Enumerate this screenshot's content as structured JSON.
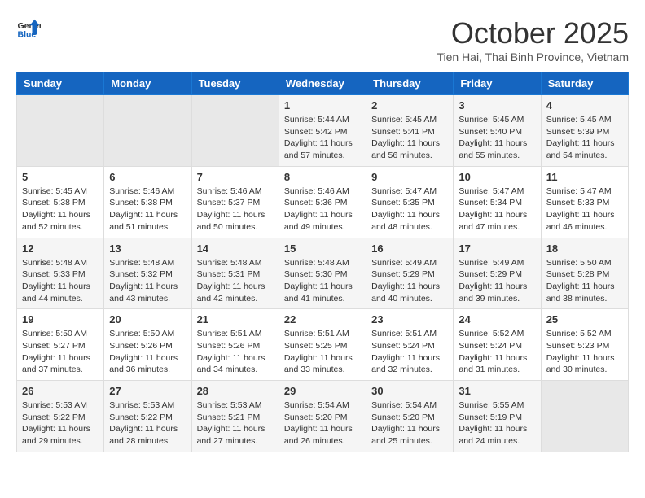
{
  "header": {
    "logo_general": "General",
    "logo_blue": "Blue",
    "title": "October 2025",
    "subtitle": "Tien Hai, Thai Binh Province, Vietnam"
  },
  "weekdays": [
    "Sunday",
    "Monday",
    "Tuesday",
    "Wednesday",
    "Thursday",
    "Friday",
    "Saturday"
  ],
  "weeks": [
    [
      {
        "day": "",
        "info": ""
      },
      {
        "day": "",
        "info": ""
      },
      {
        "day": "",
        "info": ""
      },
      {
        "day": "1",
        "info": "Sunrise: 5:44 AM\nSunset: 5:42 PM\nDaylight: 11 hours\nand 57 minutes."
      },
      {
        "day": "2",
        "info": "Sunrise: 5:45 AM\nSunset: 5:41 PM\nDaylight: 11 hours\nand 56 minutes."
      },
      {
        "day": "3",
        "info": "Sunrise: 5:45 AM\nSunset: 5:40 PM\nDaylight: 11 hours\nand 55 minutes."
      },
      {
        "day": "4",
        "info": "Sunrise: 5:45 AM\nSunset: 5:39 PM\nDaylight: 11 hours\nand 54 minutes."
      }
    ],
    [
      {
        "day": "5",
        "info": "Sunrise: 5:45 AM\nSunset: 5:38 PM\nDaylight: 11 hours\nand 52 minutes."
      },
      {
        "day": "6",
        "info": "Sunrise: 5:46 AM\nSunset: 5:38 PM\nDaylight: 11 hours\nand 51 minutes."
      },
      {
        "day": "7",
        "info": "Sunrise: 5:46 AM\nSunset: 5:37 PM\nDaylight: 11 hours\nand 50 minutes."
      },
      {
        "day": "8",
        "info": "Sunrise: 5:46 AM\nSunset: 5:36 PM\nDaylight: 11 hours\nand 49 minutes."
      },
      {
        "day": "9",
        "info": "Sunrise: 5:47 AM\nSunset: 5:35 PM\nDaylight: 11 hours\nand 48 minutes."
      },
      {
        "day": "10",
        "info": "Sunrise: 5:47 AM\nSunset: 5:34 PM\nDaylight: 11 hours\nand 47 minutes."
      },
      {
        "day": "11",
        "info": "Sunrise: 5:47 AM\nSunset: 5:33 PM\nDaylight: 11 hours\nand 46 minutes."
      }
    ],
    [
      {
        "day": "12",
        "info": "Sunrise: 5:48 AM\nSunset: 5:33 PM\nDaylight: 11 hours\nand 44 minutes."
      },
      {
        "day": "13",
        "info": "Sunrise: 5:48 AM\nSunset: 5:32 PM\nDaylight: 11 hours\nand 43 minutes."
      },
      {
        "day": "14",
        "info": "Sunrise: 5:48 AM\nSunset: 5:31 PM\nDaylight: 11 hours\nand 42 minutes."
      },
      {
        "day": "15",
        "info": "Sunrise: 5:48 AM\nSunset: 5:30 PM\nDaylight: 11 hours\nand 41 minutes."
      },
      {
        "day": "16",
        "info": "Sunrise: 5:49 AM\nSunset: 5:29 PM\nDaylight: 11 hours\nand 40 minutes."
      },
      {
        "day": "17",
        "info": "Sunrise: 5:49 AM\nSunset: 5:29 PM\nDaylight: 11 hours\nand 39 minutes."
      },
      {
        "day": "18",
        "info": "Sunrise: 5:50 AM\nSunset: 5:28 PM\nDaylight: 11 hours\nand 38 minutes."
      }
    ],
    [
      {
        "day": "19",
        "info": "Sunrise: 5:50 AM\nSunset: 5:27 PM\nDaylight: 11 hours\nand 37 minutes."
      },
      {
        "day": "20",
        "info": "Sunrise: 5:50 AM\nSunset: 5:26 PM\nDaylight: 11 hours\nand 36 minutes."
      },
      {
        "day": "21",
        "info": "Sunrise: 5:51 AM\nSunset: 5:26 PM\nDaylight: 11 hours\nand 34 minutes."
      },
      {
        "day": "22",
        "info": "Sunrise: 5:51 AM\nSunset: 5:25 PM\nDaylight: 11 hours\nand 33 minutes."
      },
      {
        "day": "23",
        "info": "Sunrise: 5:51 AM\nSunset: 5:24 PM\nDaylight: 11 hours\nand 32 minutes."
      },
      {
        "day": "24",
        "info": "Sunrise: 5:52 AM\nSunset: 5:24 PM\nDaylight: 11 hours\nand 31 minutes."
      },
      {
        "day": "25",
        "info": "Sunrise: 5:52 AM\nSunset: 5:23 PM\nDaylight: 11 hours\nand 30 minutes."
      }
    ],
    [
      {
        "day": "26",
        "info": "Sunrise: 5:53 AM\nSunset: 5:22 PM\nDaylight: 11 hours\nand 29 minutes."
      },
      {
        "day": "27",
        "info": "Sunrise: 5:53 AM\nSunset: 5:22 PM\nDaylight: 11 hours\nand 28 minutes."
      },
      {
        "day": "28",
        "info": "Sunrise: 5:53 AM\nSunset: 5:21 PM\nDaylight: 11 hours\nand 27 minutes."
      },
      {
        "day": "29",
        "info": "Sunrise: 5:54 AM\nSunset: 5:20 PM\nDaylight: 11 hours\nand 26 minutes."
      },
      {
        "day": "30",
        "info": "Sunrise: 5:54 AM\nSunset: 5:20 PM\nDaylight: 11 hours\nand 25 minutes."
      },
      {
        "day": "31",
        "info": "Sunrise: 5:55 AM\nSunset: 5:19 PM\nDaylight: 11 hours\nand 24 minutes."
      },
      {
        "day": "",
        "info": ""
      }
    ]
  ]
}
